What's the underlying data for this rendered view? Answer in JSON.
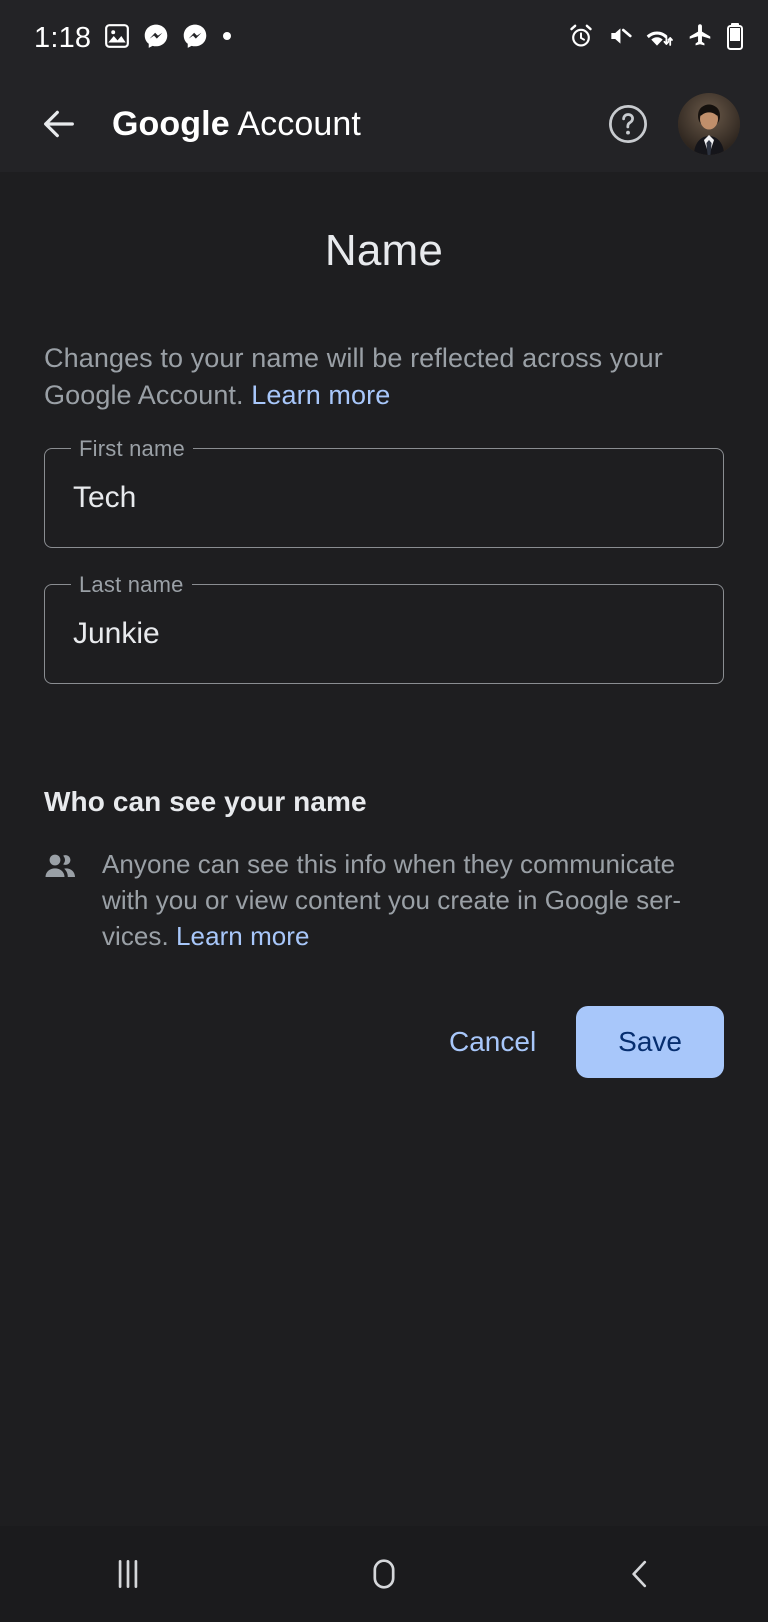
{
  "status_bar": {
    "clock": "1:18",
    "left_icons": [
      "photos-icon",
      "messenger-icon",
      "messenger-icon",
      "dot-icon"
    ],
    "right_icons": [
      "alarm-icon",
      "volume-mute-icon",
      "wifi-icon",
      "airplane-mode-icon",
      "battery-icon"
    ]
  },
  "app_bar": {
    "back_icon": "back-arrow-icon",
    "title_brand": "Google",
    "title_rest": " Account",
    "help_icon": "help-circle-icon",
    "avatar": "account-avatar"
  },
  "page": {
    "title": "Name",
    "description_before": "Changes to your name will be reflected across your Google Account. ",
    "description_link": "Learn more"
  },
  "fields": [
    {
      "label": "First name",
      "value": "Tech",
      "placeholder": "First name"
    },
    {
      "label": "Last name",
      "value": "Junkie",
      "placeholder": "Last name"
    }
  ],
  "visibility": {
    "heading": "Who can see your name",
    "icon": "people-icon",
    "text_before": "Anyone can see this info when they communicate with you or view content you create in Google ser­vices. ",
    "link": "Learn more"
  },
  "actions": {
    "cancel_label": "Cancel",
    "save_label": "Save"
  },
  "nav_bar": {
    "recents": "recents-icon",
    "home": "home-icon",
    "back": "back-icon"
  },
  "colors": {
    "background": "#1e1e20",
    "app_bar": "#232326",
    "accent": "#a8c7fa",
    "save_text": "#062e6f",
    "secondary_text": "#9aa0a6",
    "primary_text": "#e8eaed"
  }
}
